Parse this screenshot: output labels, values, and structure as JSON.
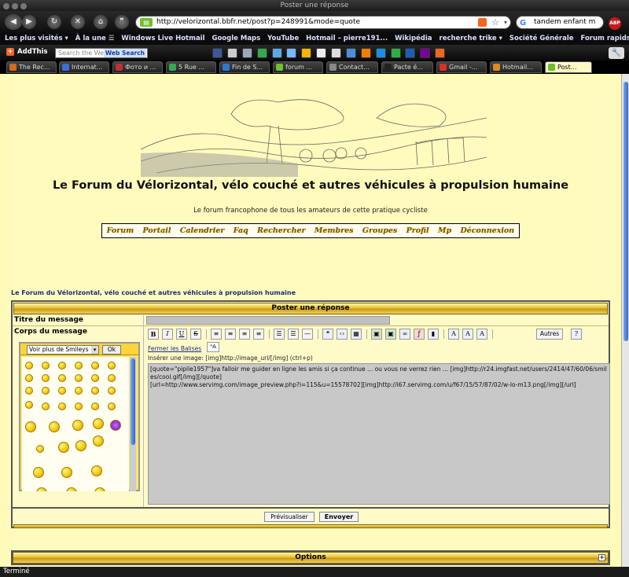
{
  "window": {
    "title": "Poster une réponse"
  },
  "browser": {
    "url": "http://velorizontal.bbfr.net/post?p=248991&mode=quote",
    "search_query": "tandem enfant m",
    "bookmarks": [
      "Les plus visités ▾",
      "À la une ☰",
      "Windows Live Hotmail",
      "Google Maps",
      "YouTube",
      "Hotmail – pierre191...",
      "Wikipédia",
      "recherche trike ▾",
      "Société Générale",
      "Forum rapidshare P..."
    ],
    "addthis_label": "AddThis",
    "web_search_placeholder": "Search the Web",
    "web_search_button": "Web Search",
    "tabs": [
      {
        "label": "The Rec...",
        "color": "#d2691e"
      },
      {
        "label": "Internat...",
        "color": "#3a6fd8"
      },
      {
        "label": "Фото и ...",
        "color": "#c03030"
      },
      {
        "label": "5 Rue ...",
        "color": "#34a853"
      },
      {
        "label": "Fin de S...",
        "color": "#2a7ad0"
      },
      {
        "label": "forum ...",
        "color": "#6fbf2e"
      },
      {
        "label": "Contact...",
        "color": "#888888"
      },
      {
        "label": "Pacte é...",
        "color": "#222222"
      },
      {
        "label": "Gmail -...",
        "color": "#d93025"
      },
      {
        "label": "Hotmail...",
        "color": "#e08a1e"
      },
      {
        "label": "Post...",
        "color": "#6fbf2e"
      }
    ],
    "status": "Terminé"
  },
  "forum": {
    "title": "Le Forum du Vélorizontal, vélo couché et autres véhicules à propulsion humaine",
    "subtitle": "Le forum francophone de tous les amateurs de cette pratique cycliste",
    "menu": [
      "Forum",
      "Portail",
      "Calendrier",
      "Faq",
      "Rechercher",
      "Membres",
      "Groupes",
      "Profil",
      "Mp",
      "Déconnexion"
    ],
    "breadcrumb": "Le Forum du Vélorizontal, vélo couché et autres véhicules à propulsion humaine"
  },
  "post": {
    "header": "Poster une réponse",
    "title_label": "Titre du message",
    "body_label": "Corps du message",
    "smileys_select": "Voir plus de Smileys",
    "smileys_ok": "Ok",
    "toolbar_more": "Autres",
    "close_tags": "Fermer les Balises",
    "insert_image": "Insérer une image: [img]http://image_url/[/img] (ctrl+p)",
    "message": "[quote=\"pipile1957\"]va falloir me guider en ligne les amis si ça continue ... ou vous ne verrez rien ... [img]http://r24.imgfast.net/users/2414/47/60/06/smiles/cool.gif[/img][/quote]\n[url=http://www.servimg.com/image_preview.php?i=115&u=15578702][img]http://i67.servimg.com/u/f67/15/57/87/02/w-lo-m13.png[/img][/url]",
    "preview_button": "Prévisualiser",
    "send_button": "Envoyer",
    "options_label": "Options"
  }
}
